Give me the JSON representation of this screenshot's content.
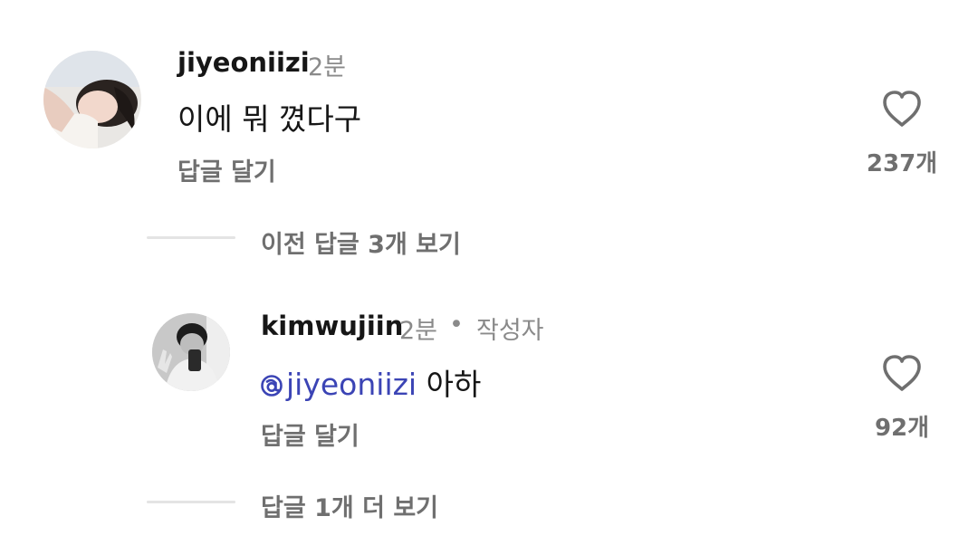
{
  "comments": [
    {
      "username": "jiyeoniizi",
      "time": "2분",
      "text": "이에 뭐 꼈다구",
      "reply_label": "답글 달기",
      "likes": "237개"
    },
    {
      "username": "kimwujiin",
      "time": "2분",
      "separator": "•",
      "author_badge": "작성자",
      "mention": "jiyeoniizi",
      "text": "아하",
      "reply_label": "답글 달기",
      "likes": "92개"
    }
  ],
  "thread": {
    "previous_replies": "이전 답글 3개 보기",
    "more_replies": "답글 1개 더 보기"
  },
  "icons": {
    "like": "heart-outline-icon",
    "mention_prefix": "threads-at-icon"
  },
  "colors": {
    "mention": "#3b44b5",
    "secondary_text": "#6f6f6f",
    "timestamp": "#8a8a8a"
  }
}
